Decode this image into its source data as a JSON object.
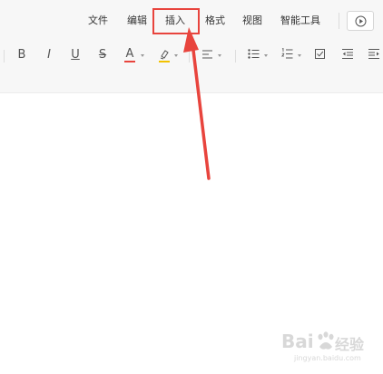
{
  "menu": {
    "items": [
      "文件",
      "编辑",
      "插入",
      "格式",
      "视图",
      "智能工具"
    ],
    "highlighted": "插入"
  },
  "toolbar": {
    "bold": "B",
    "italic": "I",
    "underline": "U",
    "strikethrough": "S",
    "font_color": "A"
  },
  "icons": {
    "play": "play-circle-icon",
    "highlight": "highlighter-icon",
    "align": "align-left-icon",
    "bulleted_list": "bulleted-list-icon",
    "numbered_list": "numbered-list-icon",
    "checkbox": "checkbox-icon",
    "indent_decrease": "indent-decrease-icon",
    "indent_increase": "indent-increase-icon"
  },
  "watermark": {
    "brand": "Bai",
    "suffix": "经验",
    "url": "jingyan.baidu.com"
  },
  "colors": {
    "annotation": "#e8443d",
    "font_color_underline": "#e8443d",
    "highlighter": "#f2c200",
    "menubar_bg": "#f7f7f7"
  }
}
